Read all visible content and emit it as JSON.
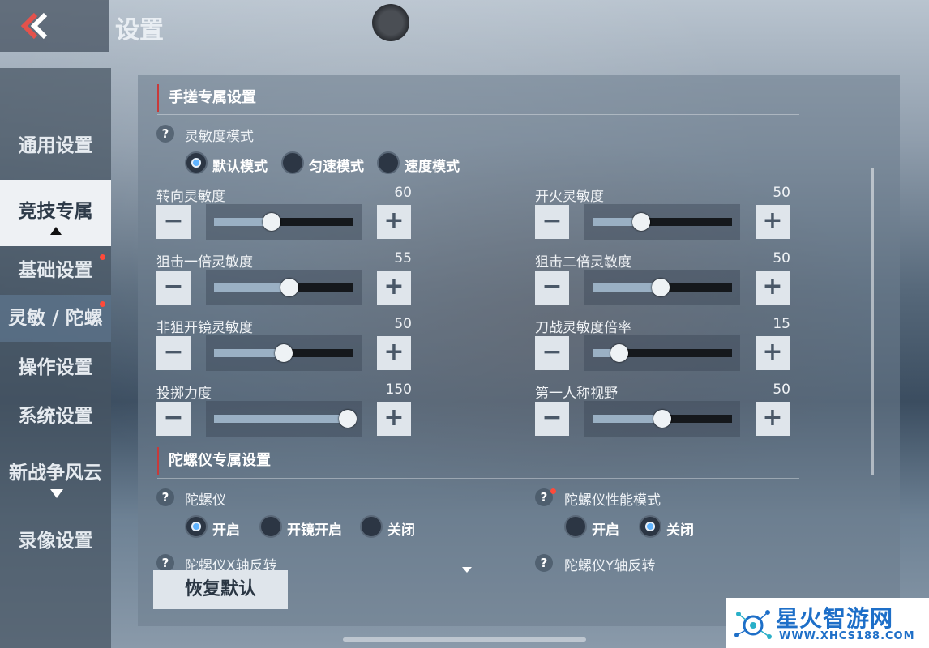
{
  "header": {
    "title": "设置"
  },
  "sidebar": {
    "items": [
      {
        "label": "通用设置"
      },
      {
        "label": "竞技专属"
      },
      {
        "label": "基础设置"
      },
      {
        "label": "灵敏 / 陀螺"
      },
      {
        "label": "操作设置"
      },
      {
        "label": "系统设置"
      },
      {
        "label": "新战争风云"
      },
      {
        "label": "录像设置"
      }
    ]
  },
  "section1": {
    "title": "手搓专属设置",
    "mode_label": "灵敏度模式",
    "modes": [
      {
        "label": "默认模式",
        "selected": true
      },
      {
        "label": "匀速模式",
        "selected": false
      },
      {
        "label": "速度模式",
        "selected": false
      }
    ],
    "sliders": [
      {
        "name": "转向灵敏度",
        "value": "60",
        "fraction": 0.41
      },
      {
        "name": "开火灵敏度",
        "value": "50",
        "fraction": 0.35
      },
      {
        "name": "狙击一倍灵敏度",
        "value": "55",
        "fraction": 0.54
      },
      {
        "name": "狙击二倍灵敏度",
        "value": "50",
        "fraction": 0.49
      },
      {
        "name": "非狙开镜灵敏度",
        "value": "50",
        "fraction": 0.5
      },
      {
        "name": "刀战灵敏度倍率",
        "value": "15",
        "fraction": 0.19
      },
      {
        "name": "投掷力度",
        "value": "150",
        "fraction": 0.96
      },
      {
        "name": "第一人称视野",
        "value": "50",
        "fraction": 0.5
      }
    ]
  },
  "section2": {
    "title": "陀螺仪专属设置",
    "gyro_label": "陀螺仪",
    "gyro_options": [
      {
        "label": "开启",
        "selected": true
      },
      {
        "label": "开镜开启",
        "selected": false
      },
      {
        "label": "关闭",
        "selected": false
      }
    ],
    "perf_label": "陀螺仪性能模式",
    "perf_options": [
      {
        "label": "开启",
        "selected": false
      },
      {
        "label": "关闭",
        "selected": true
      }
    ],
    "x_invert_label": "陀螺仪X轴反转",
    "y_invert_label": "陀螺仪Y轴反转"
  },
  "footer": {
    "reset_label": "恢复默认"
  },
  "watermark": {
    "name": "星火智游网",
    "url": "WWW.XHCS188.COM"
  }
}
